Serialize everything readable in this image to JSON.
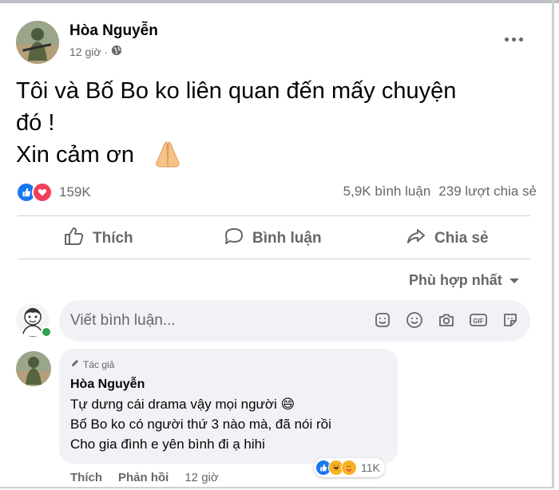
{
  "post": {
    "author": "Hòa Nguyễn",
    "time": "12 giờ",
    "text_line1": "Tôi và Bố Bo ko liên quan đến mấy chuyện",
    "text_line2": "đó !",
    "text_line3": "Xin cảm ơn",
    "privacy_icon": "globe-icon"
  },
  "reactions": {
    "count": "159K",
    "types": [
      "like",
      "love"
    ],
    "comments": "5,9K bình luận",
    "shares": "239 lượt chia sẻ"
  },
  "actions": {
    "like": "Thích",
    "comment": "Bình luận",
    "share": "Chia sẻ"
  },
  "sort": {
    "label": "Phù hợp nhất"
  },
  "composer": {
    "placeholder": "Viết bình luận...",
    "icons": [
      "sticker-icon",
      "emoji-icon",
      "camera-icon",
      "gif-icon",
      "avatar-sticker-icon"
    ]
  },
  "comment": {
    "badge": "Tác giả",
    "author": "Hòa Nguyễn",
    "line1": "Tự dưng cái drama vậy mọi người 😄",
    "line2": "Bố Bo ko có người thứ 3 nào mà, đã nói rồi",
    "line3": "Cho gia đình e yên bình đi ạ hihi",
    "reaction_count": "11K",
    "like_label": "Thích",
    "reply_label": "Phản hồi",
    "time": "12 giờ"
  },
  "colors": {
    "accent": "#1877f2",
    "love": "#f33e58",
    "muted_text": "#65676b",
    "bubble": "#f0f2f5"
  }
}
